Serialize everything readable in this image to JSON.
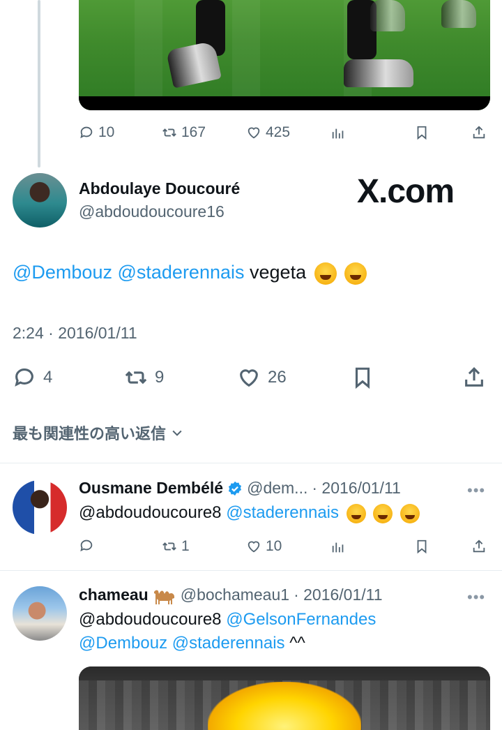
{
  "prev_tweet": {
    "actions": {
      "replies": "10",
      "retweets": "167",
      "likes": "425"
    }
  },
  "main_tweet": {
    "name": "Abdoulaye Doucouré",
    "handle": "@abdoudoucoure16",
    "watermark": "X.com",
    "text": {
      "mention1": "@Dembouz",
      "mention2": "@staderennais",
      "body": "vegeta"
    },
    "timestamp": "2:24 · 2016/01/11",
    "actions": {
      "replies": "4",
      "retweets": "9",
      "likes": "26"
    }
  },
  "sort": {
    "label": "最も関連性の高い返信"
  },
  "replies": [
    {
      "name": "Ousmane Dembélé",
      "handle": "@dem...",
      "date": "· 2016/01/11",
      "more": "•••",
      "text_mention1": "@abdoudoucoure8",
      "text_mention2": "@staderennais",
      "actions": {
        "replies": "",
        "retweets": "1",
        "likes": "10"
      }
    },
    {
      "name": "chameau",
      "handle": "@bochameau1",
      "date": "· 2016/01/11",
      "more": "•••",
      "line1_mention1": "@abdoudoucoure8",
      "line1_mention2": "@GelsonFernandes",
      "line2_mention1": "@Dembouz",
      "line2_mention2": "@staderennais",
      "line2_tail": "^^"
    }
  ],
  "colors": {
    "link": "#1d9bf0",
    "muted": "#536471",
    "text": "#0f1419",
    "verified": "#1d9bf0"
  }
}
